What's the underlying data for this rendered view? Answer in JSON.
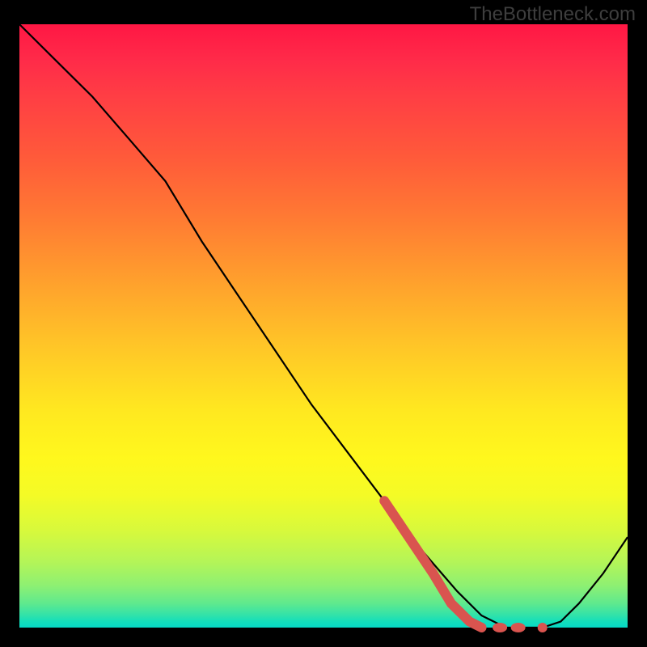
{
  "watermark": "TheBottleneck.com",
  "chart_data": {
    "type": "line",
    "title": "",
    "xlabel": "",
    "ylabel": "",
    "xlim": [
      0,
      100
    ],
    "ylim": [
      0,
      100
    ],
    "grid": false,
    "series": [
      {
        "name": "bottleneck-curve",
        "stroke": "#000000",
        "x": [
          0,
          6,
          12,
          18,
          24,
          30,
          36,
          42,
          48,
          54,
          60,
          66,
          72,
          76,
          80,
          83,
          86,
          89,
          92,
          96,
          100
        ],
        "y": [
          100,
          94,
          88,
          81,
          74,
          64,
          55,
          46,
          37,
          29,
          21,
          13,
          6,
          2,
          0,
          0,
          0,
          1,
          4,
          9,
          15
        ]
      },
      {
        "name": "highlight-segment",
        "stroke": "#d9544f",
        "x": [
          60,
          64,
          68,
          71,
          74,
          76
        ],
        "y": [
          21,
          15,
          9,
          4,
          1,
          0
        ]
      }
    ],
    "highlight_dots": [
      {
        "x": 79,
        "y": 0
      },
      {
        "x": 82,
        "y": 0
      },
      {
        "x": 86,
        "y": 0
      }
    ],
    "gradient_colors": {
      "top": "#ff1744",
      "mid": "#ffe820",
      "bottom": "#06d8c5"
    }
  }
}
